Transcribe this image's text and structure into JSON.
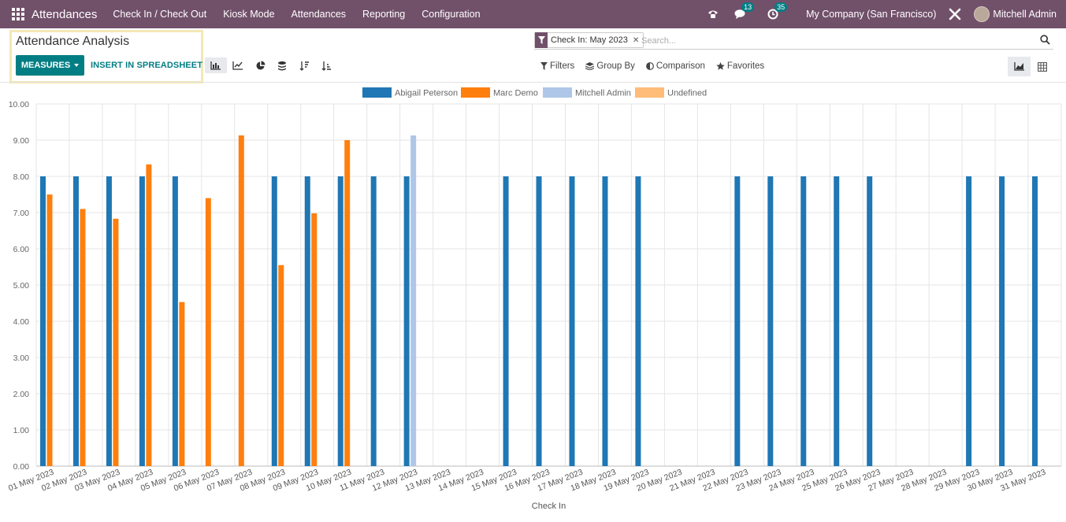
{
  "navbar": {
    "app_name": "Attendances",
    "menu": [
      "Check In / Check Out",
      "Kiosk Mode",
      "Attendances",
      "Reporting",
      "Configuration"
    ],
    "messages_count": "13",
    "activities_count": "35",
    "company": "My Company (San Francisco)",
    "user": "Mitchell Admin",
    "icons": [
      "apps-icon",
      "phone-icon",
      "chat-icon",
      "clock-icon",
      "tools-icon",
      "avatar"
    ]
  },
  "control_panel": {
    "title": "Attendance Analysis",
    "measures_label": "MEASURES",
    "insert_label": "INSERT IN SPREADSHEET",
    "facet_label": "Check In: May 2023",
    "search_placeholder": "Search...",
    "filters_label": "Filters",
    "group_by_label": "Group By",
    "comparison_label": "Comparison",
    "favorites_label": "Favorites"
  },
  "colors": {
    "navbar": "#71506a",
    "accent": "#017e84",
    "highlight_box": "#f3e8b5"
  },
  "chart_data": {
    "type": "bar",
    "xlabel": "Check In",
    "ylabel": "",
    "ylim": [
      0,
      10
    ],
    "yticks": [
      "0.00",
      "1.00",
      "2.00",
      "3.00",
      "4.00",
      "5.00",
      "6.00",
      "7.00",
      "8.00",
      "9.00",
      "10.00"
    ],
    "grid": true,
    "legend_position": "top-center",
    "categories": [
      "01 May 2023",
      "02 May 2023",
      "03 May 2023",
      "04 May 2023",
      "05 May 2023",
      "06 May 2023",
      "07 May 2023",
      "08 May 2023",
      "09 May 2023",
      "10 May 2023",
      "11 May 2023",
      "12 May 2023",
      "13 May 2023",
      "14 May 2023",
      "15 May 2023",
      "16 May 2023",
      "17 May 2023",
      "18 May 2023",
      "19 May 2023",
      "20 May 2023",
      "21 May 2023",
      "22 May 2023",
      "23 May 2023",
      "24 May 2023",
      "25 May 2023",
      "26 May 2023",
      "27 May 2023",
      "28 May 2023",
      "29 May 2023",
      "30 May 2023",
      "31 May 2023"
    ],
    "series": [
      {
        "name": "Abigail Peterson",
        "color": "#1f77b4",
        "values": [
          8,
          8,
          8,
          8,
          8,
          0,
          0,
          8,
          8,
          8,
          8,
          8,
          0,
          0,
          8,
          8,
          8,
          8,
          8,
          0,
          0,
          8,
          8,
          8,
          8,
          8,
          0,
          0,
          8,
          8,
          8
        ]
      },
      {
        "name": "Marc Demo",
        "color": "#ff7f0e",
        "values": [
          7.5,
          7.1,
          6.83,
          8.33,
          4.53,
          7.4,
          9.13,
          5.55,
          6.98,
          9.0,
          0,
          0,
          0,
          0,
          0,
          0,
          0,
          0,
          0,
          0,
          0,
          0,
          0,
          0,
          0,
          0,
          0,
          0,
          0,
          0,
          0
        ]
      },
      {
        "name": "Mitchell Admin",
        "color": "#aec7e8",
        "values": [
          0,
          0,
          0,
          0,
          0,
          0,
          0,
          0,
          0,
          0,
          0,
          9.13,
          0,
          0,
          0,
          0,
          0,
          0,
          0,
          0,
          0,
          0,
          0,
          0,
          0,
          0,
          0,
          0,
          0,
          0,
          0
        ]
      },
      {
        "name": "Undefined",
        "color": "#ffbb78",
        "values": [
          0,
          0,
          0,
          0,
          0,
          0,
          0,
          0,
          0,
          0,
          0,
          0,
          0,
          0,
          0,
          0,
          0,
          0,
          0,
          0,
          0,
          0,
          0,
          0,
          0,
          0,
          0,
          0,
          0,
          0,
          0
        ]
      }
    ]
  }
}
